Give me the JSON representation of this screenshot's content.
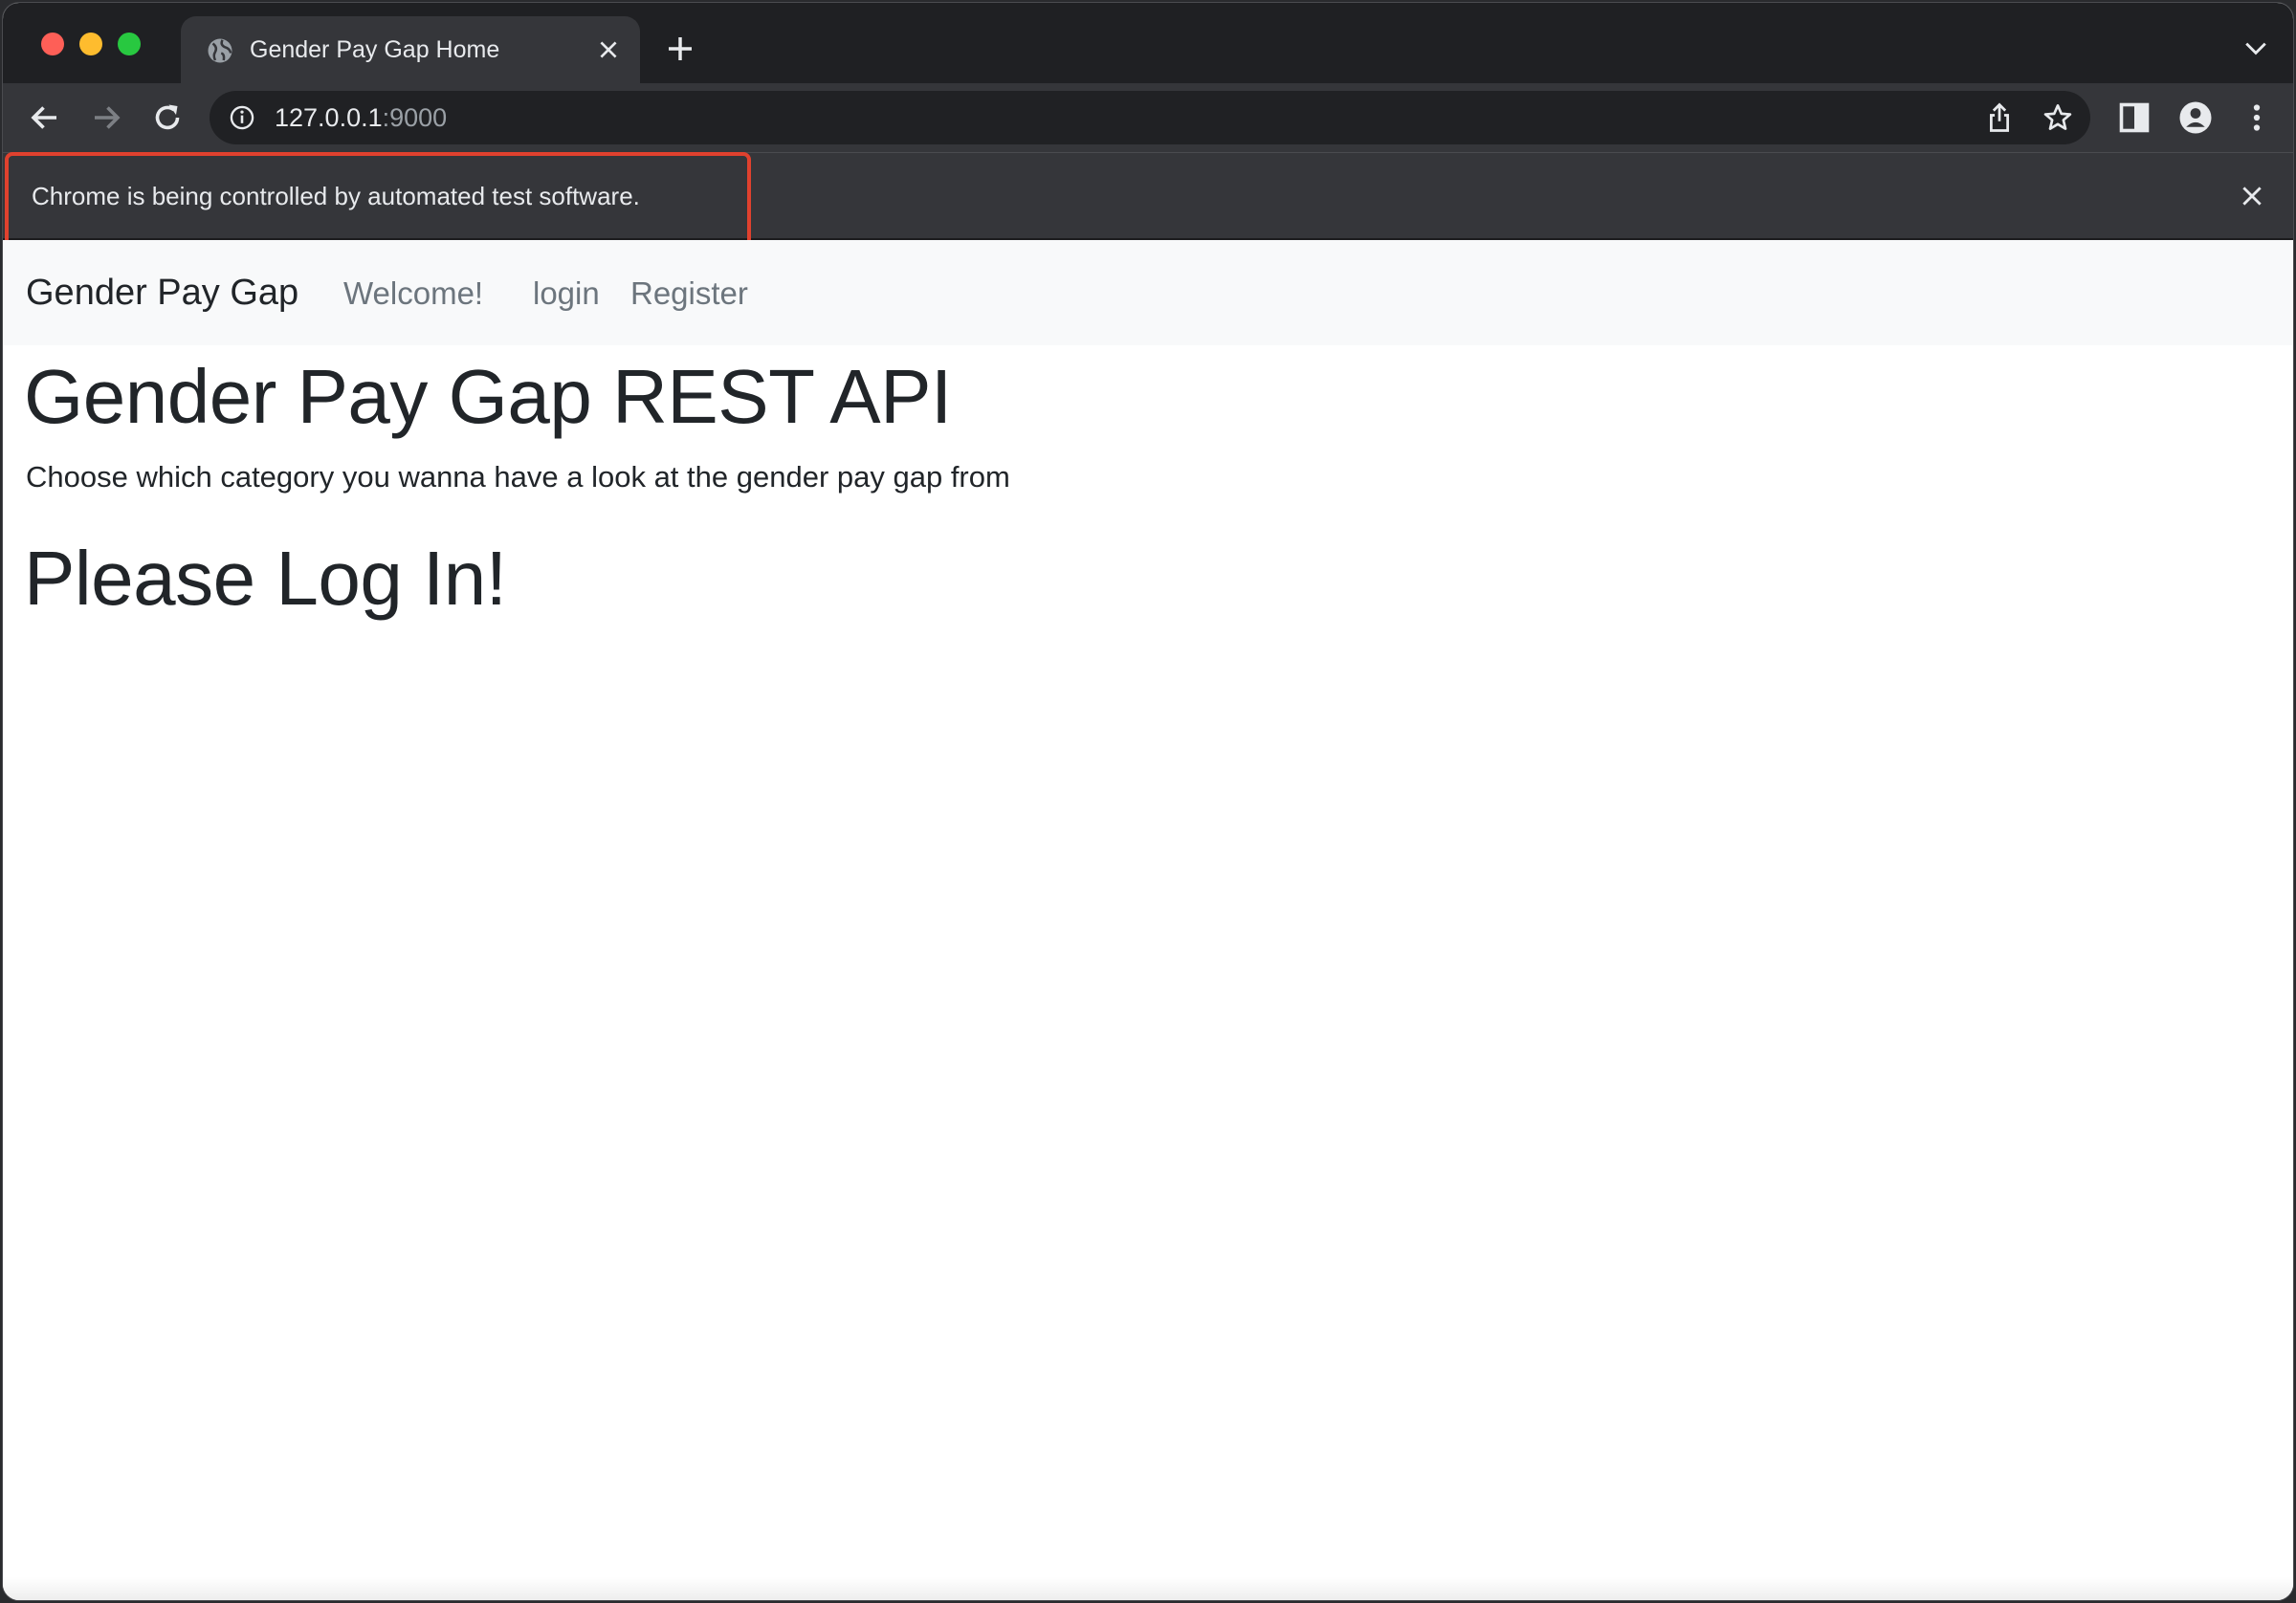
{
  "browser": {
    "tab_title": "Gender Pay Gap Home",
    "url_host": "127.0.0.1",
    "url_port": ":9000",
    "infobar_message": "Chrome is being controlled by automated test software."
  },
  "navbar": {
    "brand": "Gender Pay Gap",
    "links": [
      "Welcome!",
      "login",
      "Register"
    ]
  },
  "main": {
    "heading": "Gender Pay Gap REST API",
    "lead": "Choose which category you wanna have a look at the gender pay gap from",
    "login_prompt": "Please Log In!"
  },
  "colors": {
    "highlight_border": "#e0412e",
    "navbar_bg": "#f8f9fa",
    "chrome_dark": "#35363a"
  }
}
